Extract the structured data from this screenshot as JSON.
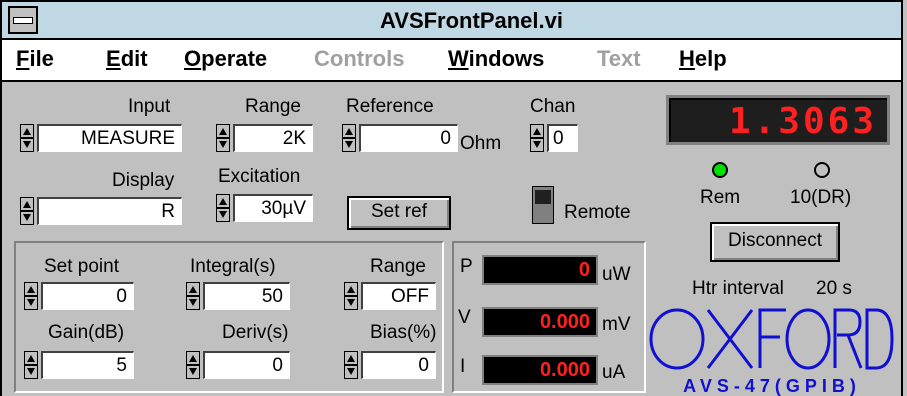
{
  "window": {
    "title": "AVSFrontPanel.vi"
  },
  "menu": [
    "File",
    "Edit",
    "Operate",
    "Controls",
    "Windows",
    "Text",
    "Help"
  ],
  "menu_disabled": [
    "Controls",
    "Text"
  ],
  "controls": {
    "input": {
      "label": "Input",
      "value": "MEASURE"
    },
    "range": {
      "label": "Range",
      "value": "2K"
    },
    "reference": {
      "label": "Reference",
      "value": "0",
      "unit": "Ohm"
    },
    "chan": {
      "label": "Chan",
      "value": "0"
    },
    "display": {
      "label": "Display",
      "value": "R"
    },
    "excitation": {
      "label": "Excitation",
      "value": "30µV"
    },
    "set_ref": "Set ref",
    "remote": "Remote"
  },
  "readout": {
    "value": "1.3063",
    "color": "#ff2020"
  },
  "leds": {
    "rem": "Rem",
    "dr": "10(DR)",
    "rem_color": "#00e000"
  },
  "disconnect": "Disconnect",
  "htr_interval": {
    "label": "Htr interval",
    "value": "20 s"
  },
  "pid": {
    "set_point": {
      "label": "Set point",
      "value": "0"
    },
    "integral": {
      "label": "Integral(s)",
      "value": "50"
    },
    "range": {
      "label": "Range",
      "value": "OFF"
    },
    "gain": {
      "label": "Gain(dB)",
      "value": "5"
    },
    "deriv": {
      "label": "Deriv(s)",
      "value": "0"
    },
    "bias": {
      "label": "Bias(%)",
      "value": "0"
    }
  },
  "meters": {
    "p": {
      "label": "P",
      "value": "0",
      "unit": "uW"
    },
    "v": {
      "label": "V",
      "value": "0.000",
      "unit": "mV"
    },
    "i": {
      "label": "I",
      "value": "0.000",
      "unit": "uA"
    }
  },
  "logo": {
    "brand": "OXFORD",
    "model": "AVS-47(GPIB)",
    "color": "#1010d0"
  }
}
